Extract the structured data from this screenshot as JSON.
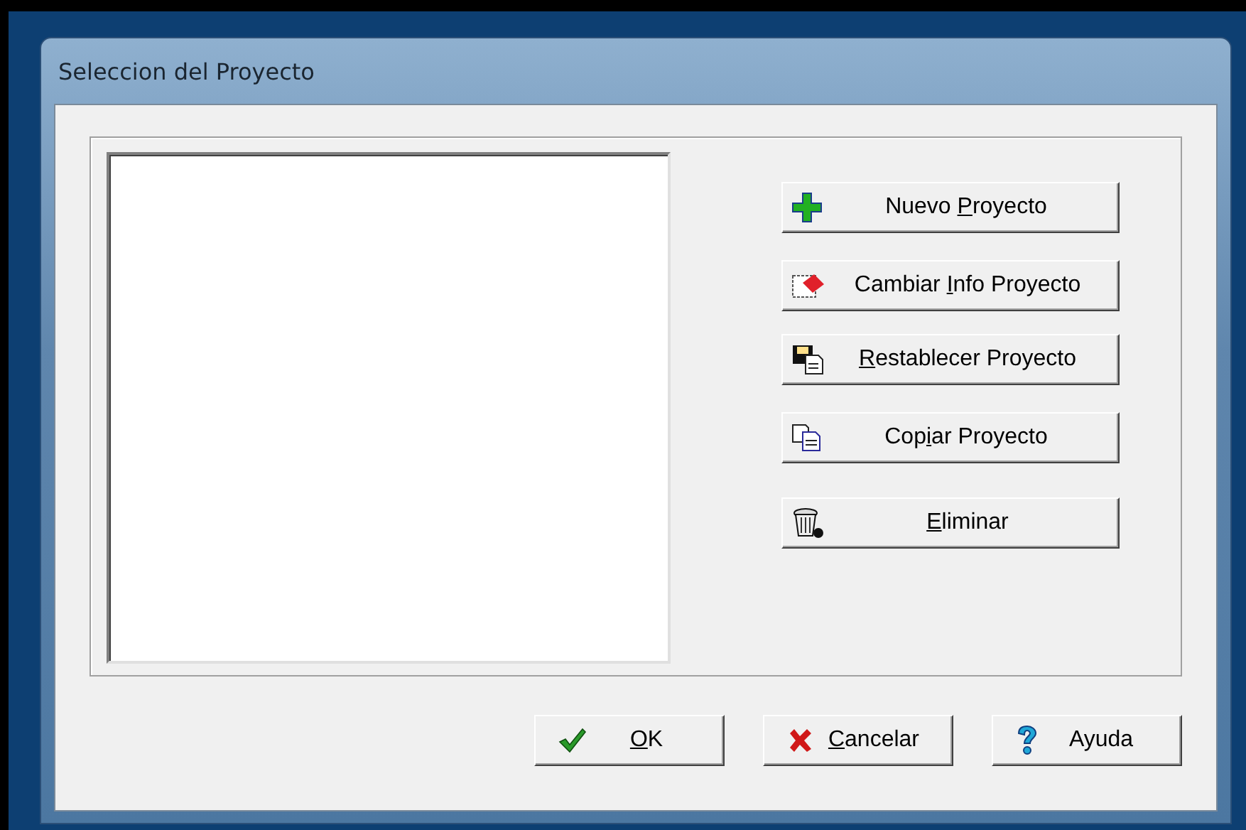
{
  "window": {
    "title": "Seleccion del Proyecto"
  },
  "actions": [
    {
      "kind": "new",
      "label_before": "Nuevo ",
      "access_key": "P",
      "label_after": "royecto"
    },
    {
      "kind": "edit",
      "label_before": "Cambiar ",
      "access_key": "I",
      "label_after": "nfo Proyecto"
    },
    {
      "kind": "restore",
      "access_key": "R",
      "label_after": "establecer Proyecto"
    },
    {
      "kind": "copy",
      "label_before": "Cop",
      "access_key": "i",
      "label_after": "ar Proyecto"
    },
    {
      "kind": "delete",
      "access_key": "E",
      "label_after": "liminar"
    }
  ],
  "footer_buttons": [
    {
      "kind": "ok",
      "access_key": "O",
      "label_after": "K"
    },
    {
      "kind": "cancel",
      "access_key": "C",
      "label_after": "ancelar"
    },
    {
      "kind": "help",
      "label_before": "Ayuda"
    }
  ]
}
